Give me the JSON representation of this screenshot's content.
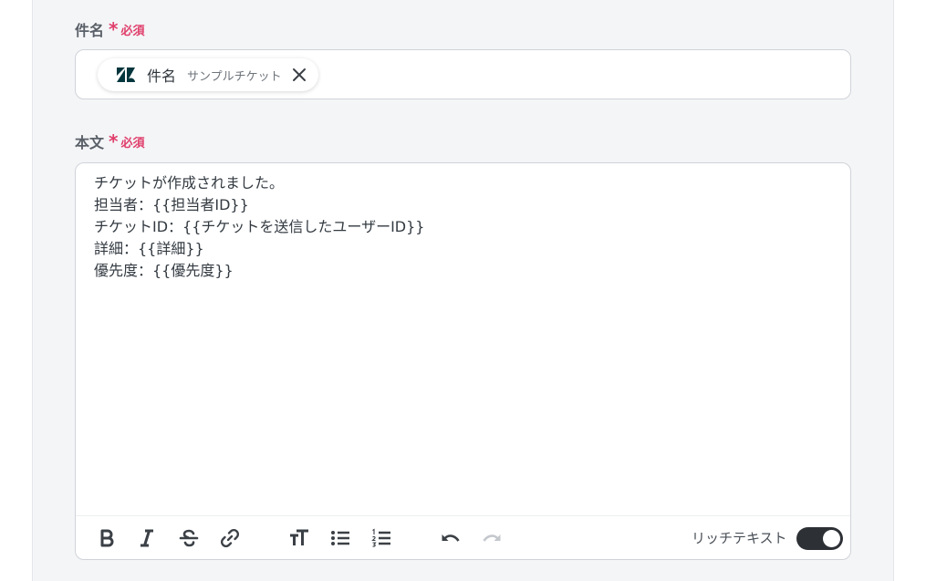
{
  "subject_field": {
    "label": "件名",
    "asterisk": "*",
    "required": "必須",
    "chip": {
      "app_icon": "zendesk-icon",
      "label": "件名",
      "sub_label": "サンプルチケット"
    }
  },
  "body_field": {
    "label": "本文",
    "asterisk": "*",
    "required": "必須",
    "lines": [
      "チケットが作成されました。",
      "担当者：{{担当者ID}}",
      "チケットID：{{チケットを送信したユーザーID}}",
      "詳細：{{詳細}}",
      "優先度：{{優先度}}"
    ]
  },
  "toolbar": {
    "buttons": [
      "bold-icon",
      "italic-icon",
      "strikethrough-icon",
      "link-icon",
      "text-size-icon",
      "bullet-list-icon",
      "numbered-list-icon",
      "undo-icon",
      "redo-icon"
    ],
    "rich_text_label": "リッチテキスト",
    "rich_text_enabled": true
  },
  "colors": {
    "accent_required": "#e03e6b",
    "toggle_on": "#2d3136",
    "zendesk_icon": "#03363d"
  }
}
